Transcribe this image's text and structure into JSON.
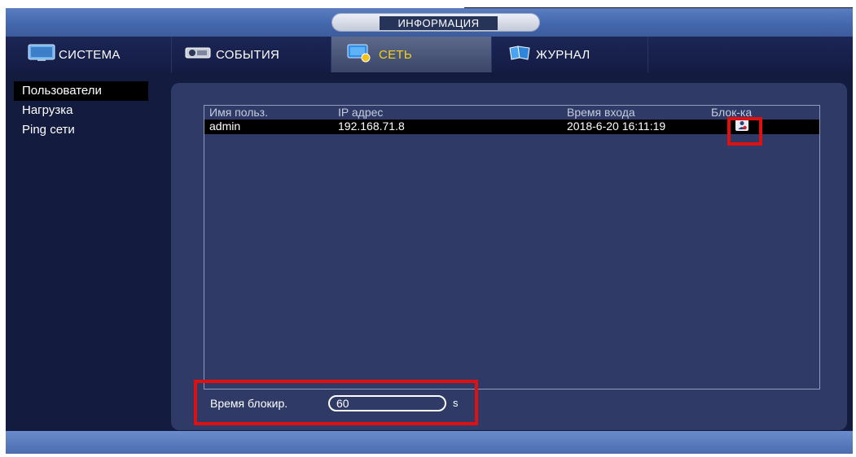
{
  "window": {
    "title": "ИНФОРМАЦИЯ"
  },
  "tabs": [
    {
      "label": "СИСТЕМА",
      "icon": "monitor-icon"
    },
    {
      "label": "СОБЫТИЯ",
      "icon": "camera-event-icon"
    },
    {
      "label": "СЕТЬ",
      "icon": "network-icon",
      "active": true
    },
    {
      "label": "ЖУРНАЛ",
      "icon": "log-book-icon"
    }
  ],
  "sidebar": {
    "items": [
      {
        "label": "Пользователи",
        "selected": true
      },
      {
        "label": "Нагрузка"
      },
      {
        "label": "Ping сети"
      }
    ]
  },
  "table": {
    "headers": [
      "Имя польз.",
      "IP адрес",
      "Время входа",
      "Блок-ка"
    ],
    "rows": [
      {
        "user": "admin",
        "ip": "192.168.71.8",
        "login_time": "2018-6-20 16:11:19",
        "block_icon": "lock-user-icon"
      }
    ]
  },
  "block_time": {
    "label": "Время блокир.",
    "value": "60",
    "unit": "s"
  },
  "colors": {
    "accent_active_tab": "#f4d11a",
    "highlight_box": "#e01010",
    "panel": "#2f3a66",
    "title_bar": "#4468ad"
  }
}
